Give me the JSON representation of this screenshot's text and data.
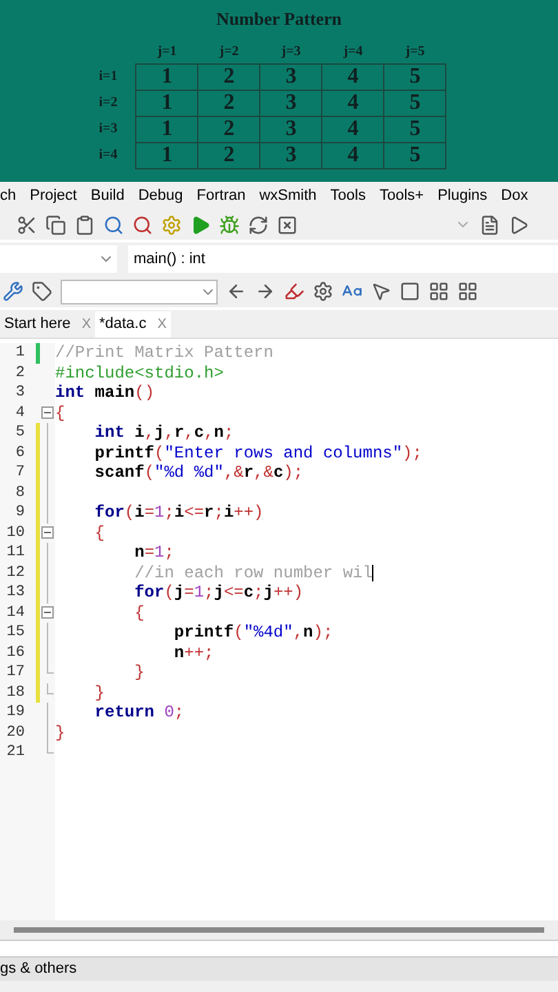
{
  "slide": {
    "title": "Number Pattern",
    "columns": [
      "j=1",
      "j=2",
      "j=3",
      "j=4",
      "j=5"
    ],
    "rows": [
      {
        "label": "i=1",
        "cells": [
          "1",
          "2",
          "3",
          "4",
          "5"
        ]
      },
      {
        "label": "i=2",
        "cells": [
          "1",
          "2",
          "3",
          "4",
          "5"
        ]
      },
      {
        "label": "i=3",
        "cells": [
          "1",
          "2",
          "3",
          "4",
          "5"
        ]
      },
      {
        "label": "i=4",
        "cells": [
          "1",
          "2",
          "3",
          "4",
          "5"
        ]
      }
    ]
  },
  "menu": [
    "ch",
    "Project",
    "Build",
    "Debug",
    "Fortran",
    "wxSmith",
    "Tools",
    "Tools+",
    "Plugins",
    "Dox"
  ],
  "function_bar": {
    "value": "main() : int"
  },
  "tabs": [
    {
      "label": "Start here",
      "selected": false,
      "close": "X"
    },
    {
      "label": "*data.c",
      "selected": true,
      "close": "X"
    }
  ],
  "editor": {
    "lines": [
      {
        "number": "1",
        "kind": "plain",
        "color": "#30c060",
        "tokens": [
          {
            "text": "//Print Matrix Pattern",
            "kind": "comment"
          }
        ]
      },
      {
        "number": "2",
        "kind": "plain",
        "tokens": [
          {
            "text": "#include<stdio.h>",
            "kind": "preproc"
          }
        ]
      },
      {
        "number": "3",
        "kind": "plain",
        "tokens": [
          {
            "text": "int",
            "kind": "keyword"
          },
          {
            "text": " main",
            "kind": "ident"
          },
          {
            "text": "()",
            "kind": "op"
          }
        ]
      },
      {
        "number": "4",
        "kind": "fold-start",
        "tokens": [
          {
            "text": "{",
            "kind": "op"
          }
        ]
      },
      {
        "number": "5",
        "kind": "fold-line",
        "color": "#e8e040",
        "tokens": [
          {
            "text": "    int",
            "kind": "keyword"
          },
          {
            "text": " i",
            "kind": "ident"
          },
          {
            "text": ",",
            "kind": "op"
          },
          {
            "text": "j",
            "kind": "ident"
          },
          {
            "text": ",",
            "kind": "op"
          },
          {
            "text": "r",
            "kind": "ident"
          },
          {
            "text": ",",
            "kind": "op"
          },
          {
            "text": "c",
            "kind": "ident"
          },
          {
            "text": ",",
            "kind": "op"
          },
          {
            "text": "n",
            "kind": "ident"
          },
          {
            "text": ";",
            "kind": "op"
          }
        ]
      },
      {
        "number": "6",
        "kind": "fold-line",
        "color": "#e8e040",
        "tokens": [
          {
            "text": "    printf",
            "kind": "ident"
          },
          {
            "text": "(",
            "kind": "op"
          },
          {
            "text": "\"Enter rows and columns\"",
            "kind": "string"
          },
          {
            "text": ");",
            "kind": "op"
          }
        ]
      },
      {
        "number": "7",
        "kind": "fold-line",
        "color": "#e8e040",
        "tokens": [
          {
            "text": "    scanf",
            "kind": "ident"
          },
          {
            "text": "(",
            "kind": "op"
          },
          {
            "text": "\"%d %d\"",
            "kind": "string"
          },
          {
            "text": ",&",
            "kind": "op"
          },
          {
            "text": "r",
            "kind": "ident"
          },
          {
            "text": ",&",
            "kind": "op"
          },
          {
            "text": "c",
            "kind": "ident"
          },
          {
            "text": ");",
            "kind": "op"
          }
        ]
      },
      {
        "number": "8",
        "kind": "fold-line",
        "color": "#e8e040"
      },
      {
        "number": "9",
        "kind": "fold-line",
        "color": "#e8e040",
        "tokens": [
          {
            "text": "    for",
            "kind": "keyword"
          },
          {
            "text": "(",
            "kind": "op"
          },
          {
            "text": "i",
            "kind": "ident"
          },
          {
            "text": "=",
            "kind": "op"
          },
          {
            "text": "1",
            "kind": "number"
          },
          {
            "text": ";",
            "kind": "op"
          },
          {
            "text": "i",
            "kind": "ident"
          },
          {
            "text": "<=",
            "kind": "op"
          },
          {
            "text": "r",
            "kind": "ident"
          },
          {
            "text": ";",
            "kind": "op"
          },
          {
            "text": "i",
            "kind": "ident"
          },
          {
            "text": "++)",
            "kind": "op"
          }
        ]
      },
      {
        "number": "10",
        "kind": "fold-start",
        "color": "#e8e040",
        "tokens": [
          {
            "text": "    {",
            "kind": "op"
          }
        ]
      },
      {
        "number": "11",
        "kind": "fold-line",
        "color": "#e8e040",
        "tokens": [
          {
            "text": "        n",
            "kind": "ident"
          },
          {
            "text": "=",
            "kind": "op"
          },
          {
            "text": "1",
            "kind": "number"
          },
          {
            "text": ";",
            "kind": "op"
          }
        ]
      },
      {
        "number": "12",
        "kind": "fold-line",
        "color": "#e8e040",
        "cursor": true,
        "tokens": [
          {
            "text": "        //in each row number wil",
            "kind": "comment"
          }
        ]
      },
      {
        "number": "13",
        "kind": "fold-line",
        "color": "#e8e040",
        "tokens": [
          {
            "text": "        for",
            "kind": "keyword"
          },
          {
            "text": "(",
            "kind": "op"
          },
          {
            "text": "j",
            "kind": "ident"
          },
          {
            "text": "=",
            "kind": "op"
          },
          {
            "text": "1",
            "kind": "number"
          },
          {
            "text": ";",
            "kind": "op"
          },
          {
            "text": "j",
            "kind": "ident"
          },
          {
            "text": "<=",
            "kind": "op"
          },
          {
            "text": "c",
            "kind": "ident"
          },
          {
            "text": ";",
            "kind": "op"
          },
          {
            "text": "j",
            "kind": "ident"
          },
          {
            "text": "++)",
            "kind": "op"
          }
        ]
      },
      {
        "number": "14",
        "kind": "fold-start",
        "color": "#e8e040",
        "tokens": [
          {
            "text": "        {",
            "kind": "op"
          }
        ]
      },
      {
        "number": "15",
        "kind": "fold-line",
        "color": "#e8e040",
        "tokens": [
          {
            "text": "            printf",
            "kind": "ident"
          },
          {
            "text": "(",
            "kind": "op"
          },
          {
            "text": "\"%4d\"",
            "kind": "string"
          },
          {
            "text": ",",
            "kind": "op"
          },
          {
            "text": "n",
            "kind": "ident"
          },
          {
            "text": ");",
            "kind": "op"
          }
        ]
      },
      {
        "number": "16",
        "kind": "fold-line",
        "color": "#e8e040",
        "tokens": [
          {
            "text": "            n",
            "kind": "ident"
          },
          {
            "text": "++;",
            "kind": "op"
          }
        ]
      },
      {
        "number": "17",
        "kind": "fold-end",
        "color": "#e8e040",
        "tokens": [
          {
            "text": "        }",
            "kind": "op"
          }
        ]
      },
      {
        "number": "18",
        "kind": "fold-end",
        "color": "#e8e040",
        "tokens": [
          {
            "text": "    }",
            "kind": "op"
          }
        ]
      },
      {
        "number": "19",
        "kind": "fold-line",
        "tokens": [
          {
            "text": "    return",
            "kind": "keyword"
          },
          {
            "text": " 0",
            "kind": "number"
          },
          {
            "text": ";",
            "kind": "op"
          }
        ]
      },
      {
        "number": "20",
        "kind": "fold-line",
        "tokens": [
          {
            "text": "}",
            "kind": "op"
          }
        ]
      },
      {
        "number": "21",
        "kind": "fold-end"
      }
    ]
  },
  "bottom_panel": {
    "title": "gs & others"
  }
}
